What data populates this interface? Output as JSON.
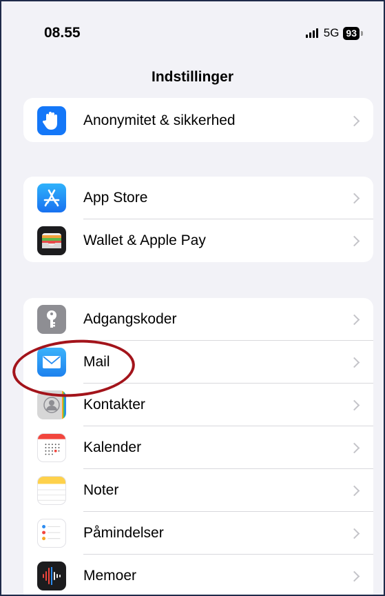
{
  "status_bar": {
    "time": "08.55",
    "network": "5G",
    "battery": "93"
  },
  "nav": {
    "title": "Indstillinger"
  },
  "groups": [
    {
      "items": [
        {
          "label": "Anonymitet & sikkerhed",
          "icon": "hand-icon"
        }
      ]
    },
    {
      "items": [
        {
          "label": "App Store",
          "icon": "app-store-icon"
        },
        {
          "label": "Wallet & Apple Pay",
          "icon": "wallet-icon"
        }
      ]
    },
    {
      "items": [
        {
          "label": "Adgangskoder",
          "icon": "key-icon"
        },
        {
          "label": "Mail",
          "icon": "mail-icon"
        },
        {
          "label": "Kontakter",
          "icon": "contacts-icon"
        },
        {
          "label": "Kalender",
          "icon": "calendar-icon"
        },
        {
          "label": "Noter",
          "icon": "notes-icon"
        },
        {
          "label": "Påmindelser",
          "icon": "reminders-icon"
        },
        {
          "label": "Memoer",
          "icon": "voice-memos-icon"
        }
      ]
    }
  ],
  "colors": {
    "background": "#f2f2f7",
    "annotation": "#a3141b",
    "privacy": "#1477f8",
    "app_store": "#1a8cf5",
    "mail": "#2d9cf5"
  }
}
